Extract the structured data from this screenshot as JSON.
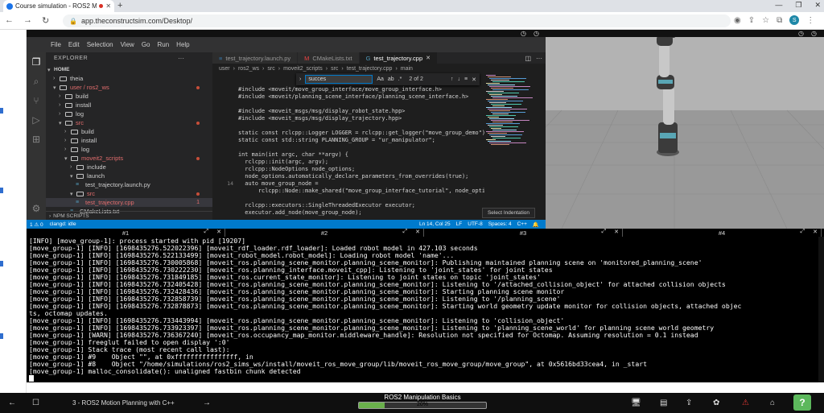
{
  "browser": {
    "tab_title": "Course simulation - ROS2 M",
    "url": "app.theconstructsim.com/Desktop/",
    "profile_initial": "S"
  },
  "vscode": {
    "menu": [
      "File",
      "Edit",
      "Selection",
      "View",
      "Go",
      "Run",
      "Help"
    ],
    "explorer_title": "EXPLORER",
    "home": "HOME",
    "tree": [
      {
        "label": "theia",
        "indent": 1,
        "kind": "folder",
        "open": false
      },
      {
        "label": "user / ros2_ws",
        "indent": 1,
        "kind": "folder",
        "open": true,
        "red": true,
        "dot": true
      },
      {
        "label": "build",
        "indent": 2,
        "kind": "folder",
        "open": false
      },
      {
        "label": "install",
        "indent": 2,
        "kind": "folder",
        "open": false
      },
      {
        "label": "log",
        "indent": 2,
        "kind": "folder",
        "open": false
      },
      {
        "label": "src",
        "indent": 2,
        "kind": "folder",
        "open": true,
        "red": true,
        "dot": true
      },
      {
        "label": "build",
        "indent": 3,
        "kind": "folder",
        "open": false
      },
      {
        "label": "install",
        "indent": 3,
        "kind": "folder",
        "open": false
      },
      {
        "label": "log",
        "indent": 3,
        "kind": "folder",
        "open": false
      },
      {
        "label": "moveit2_scripts",
        "indent": 3,
        "kind": "folder",
        "open": true,
        "red": true,
        "dot": true
      },
      {
        "label": "include",
        "indent": 4,
        "kind": "folder",
        "open": false
      },
      {
        "label": "launch",
        "indent": 4,
        "kind": "folder",
        "open": true
      },
      {
        "label": "test_trajectory.launch.py",
        "indent": 5,
        "kind": "file"
      },
      {
        "label": "src",
        "indent": 4,
        "kind": "folder",
        "open": true,
        "red": true,
        "dot": true
      },
      {
        "label": "test_trajectory.cpp",
        "indent": 5,
        "kind": "file",
        "red": true,
        "selected": true,
        "badge": "1"
      },
      {
        "label": "CMakeLists.txt",
        "indent": 4,
        "kind": "file"
      }
    ],
    "npm_scripts": "NPM SCRIPTS",
    "tabs": [
      {
        "label": "test_trajectory.launch.py",
        "active": false
      },
      {
        "label": "CMakeLists.txt",
        "active": false
      },
      {
        "label": "test_trajectory.cpp",
        "active": true
      }
    ],
    "breadcrumb": [
      "user",
      "ros2_ws",
      "src",
      "moveit2_scripts",
      "src",
      "test_trajectory.cpp",
      "main"
    ],
    "find": {
      "query": "succes",
      "result": "2 of 2"
    },
    "line_numbers": [
      "",
      "",
      "",
      "",
      "",
      "",
      "",
      "",
      "",
      "",
      "",
      "",
      "",
      "14",
      "",
      "",
      "",
      ""
    ],
    "code_lines": [
      "#include <moveit/move_group_interface/move_group_interface.h>",
      "#include <moveit/planning_scene_interface/planning_scene_interface.h>",
      "",
      "#include <moveit_msgs/msg/display_robot_state.hpp>",
      "#include <moveit_msgs/msg/display_trajectory.hpp>",
      "",
      "static const rclcpp::Logger LOGGER = rclcpp::get_logger(\"move_group_demo\");",
      "static const std::string PLANNING_GROUP = \"ur_manipulator\";",
      "",
      "int main(int argc, char **argv) {",
      "  rclcpp::init(argc, argv);",
      "  rclcpp::NodeOptions node_options;",
      "  node_options.automatically_declare_parameters_from_overrides(true);",
      "  auto move_group_node =",
      "      rclcpp::Node::make_shared(\"move_group_interface_tutorial\", node_opti",
      "",
      "  rclcpp::executors::SingleThreadedExecutor executor;",
      "  executor.add_node(move_group_node);"
    ],
    "tooltip": "Select Indentation",
    "status": {
      "problems": "1 ⚠ 0",
      "clangd": "clangd: idle",
      "position": "Ln 14, Col 25",
      "eol": "LF",
      "encoding": "UTF-8",
      "spaces": "Spaces: 4",
      "lang": "C++"
    }
  },
  "terminal": {
    "tabs": [
      "#1",
      "#2",
      "#3",
      "#4"
    ],
    "lines": [
      "[INFO] [move_group-1]: process started with pid [19207]",
      "[move_group-1] [INFO] [1698435276.522022396] [moveit_rdf_loader.rdf_loader]: Loaded robot model in 427.103 seconds",
      "[move_group-1] [INFO] [1698435276.522133499] [moveit_robot_model.robot_model]: Loading robot model 'name'...",
      "[move_group-1] [INFO] [1698435276.730005868] [moveit_ros.planning_scene_monitor.planning_scene_monitor]: Publishing maintained planning scene on 'monitored_planning_scene'",
      "[move_group-1] [INFO] [1698435276.730222230] [moveit_ros.planning_interface.moveit_cpp]: Listening to 'joint_states' for joint states",
      "[move_group-1] [INFO] [1698435276.731849185] [moveit_ros.current_state_monitor]: Listening to joint states on topic 'joint_states'",
      "[move_group-1] [INFO] [1698435276.732405428] [moveit_ros.planning_scene_monitor.planning_scene_monitor]: Listening to '/attached_collision_object' for attached collision objects",
      "[move_group-1] [INFO] [1698435276.732428436] [moveit_ros.planning_scene_monitor.planning_scene_monitor]: Starting planning scene monitor",
      "[move_group-1] [INFO] [1698435276.732858739] [moveit_ros.planning_scene_monitor.planning_scene_monitor]: Listening to '/planning_scene'",
      "[move_group-1] [INFO] [1698435276.732878873] [moveit_ros.planning_scene_monitor.planning_scene_monitor]: Starting world geometry update monitor for collision objects, attached objec",
      "ts, octomap updates.",
      "[move_group-1] [INFO] [1698435276.733443994] [moveit_ros.planning_scene_monitor.planning_scene_monitor]: Listening to 'collision_object'",
      "[move_group-1] [INFO] [1698435276.733923397] [moveit_ros.planning_scene_monitor.planning_scene_monitor]: Listening to 'planning_scene_world' for planning scene world geometry",
      "[move_group-1] [WARN] [1698435276.736367240] [moveit_ros.occupancy_map_monitor.middleware_handle]: Resolution not specified for Octomap. Assuming resolution = 0.1 instead",
      "[move_group-1] freeglut failed to open display ':0'",
      "[move_group-1] Stack trace (most recent call last):",
      "[move_group-1] #9    Object \"\", at 0xffffffffffffffff, in",
      "[move_group-1] #8    Object \"/home/simulations/ros2_sims_ws/install/moveit_ros_move_group/lib/moveit_ros_move_group/move_group\", at 0x5616bd33cea4, in _start",
      "[move_group-1] malloc_consolidate(): unaligned fastbin chunk detected"
    ]
  },
  "bottom": {
    "lesson": "3 - ROS2 Motion Planning with C++",
    "course": "ROS2 Manipulation Basics",
    "progress_label": "20%",
    "progress": 0.2,
    "help": "?"
  },
  "colors": {
    "accent": "#007acc",
    "progress": "#6ab04c",
    "help": "#5cb85c"
  }
}
